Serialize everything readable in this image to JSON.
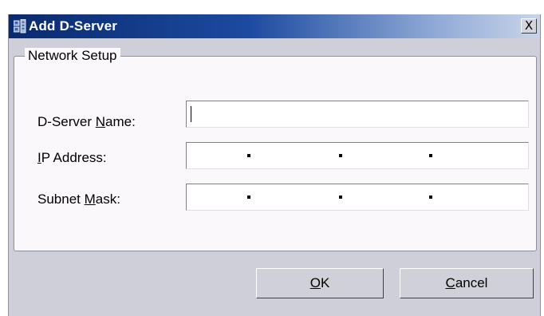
{
  "window": {
    "title": "Add D-Server",
    "close_label": "X"
  },
  "group": {
    "legend": "Network Setup"
  },
  "fields": {
    "name": {
      "label_pre": "D-Server ",
      "label_mnemonic": "N",
      "label_post": "ame:",
      "value": ""
    },
    "ip": {
      "label_pre": "",
      "label_mnemonic": "I",
      "label_post": "P Address:",
      "octets": [
        "",
        "",
        "",
        ""
      ]
    },
    "mask": {
      "label_pre": "Subnet ",
      "label_mnemonic": "M",
      "label_post": "ask:",
      "octets": [
        "",
        "",
        "",
        ""
      ]
    }
  },
  "buttons": {
    "ok": {
      "mnemonic": "O",
      "rest": "K"
    },
    "cancel": {
      "mnemonic": "C",
      "rest": "ancel"
    }
  },
  "icons": {
    "app": "network-server-icon",
    "close": "close-icon"
  }
}
